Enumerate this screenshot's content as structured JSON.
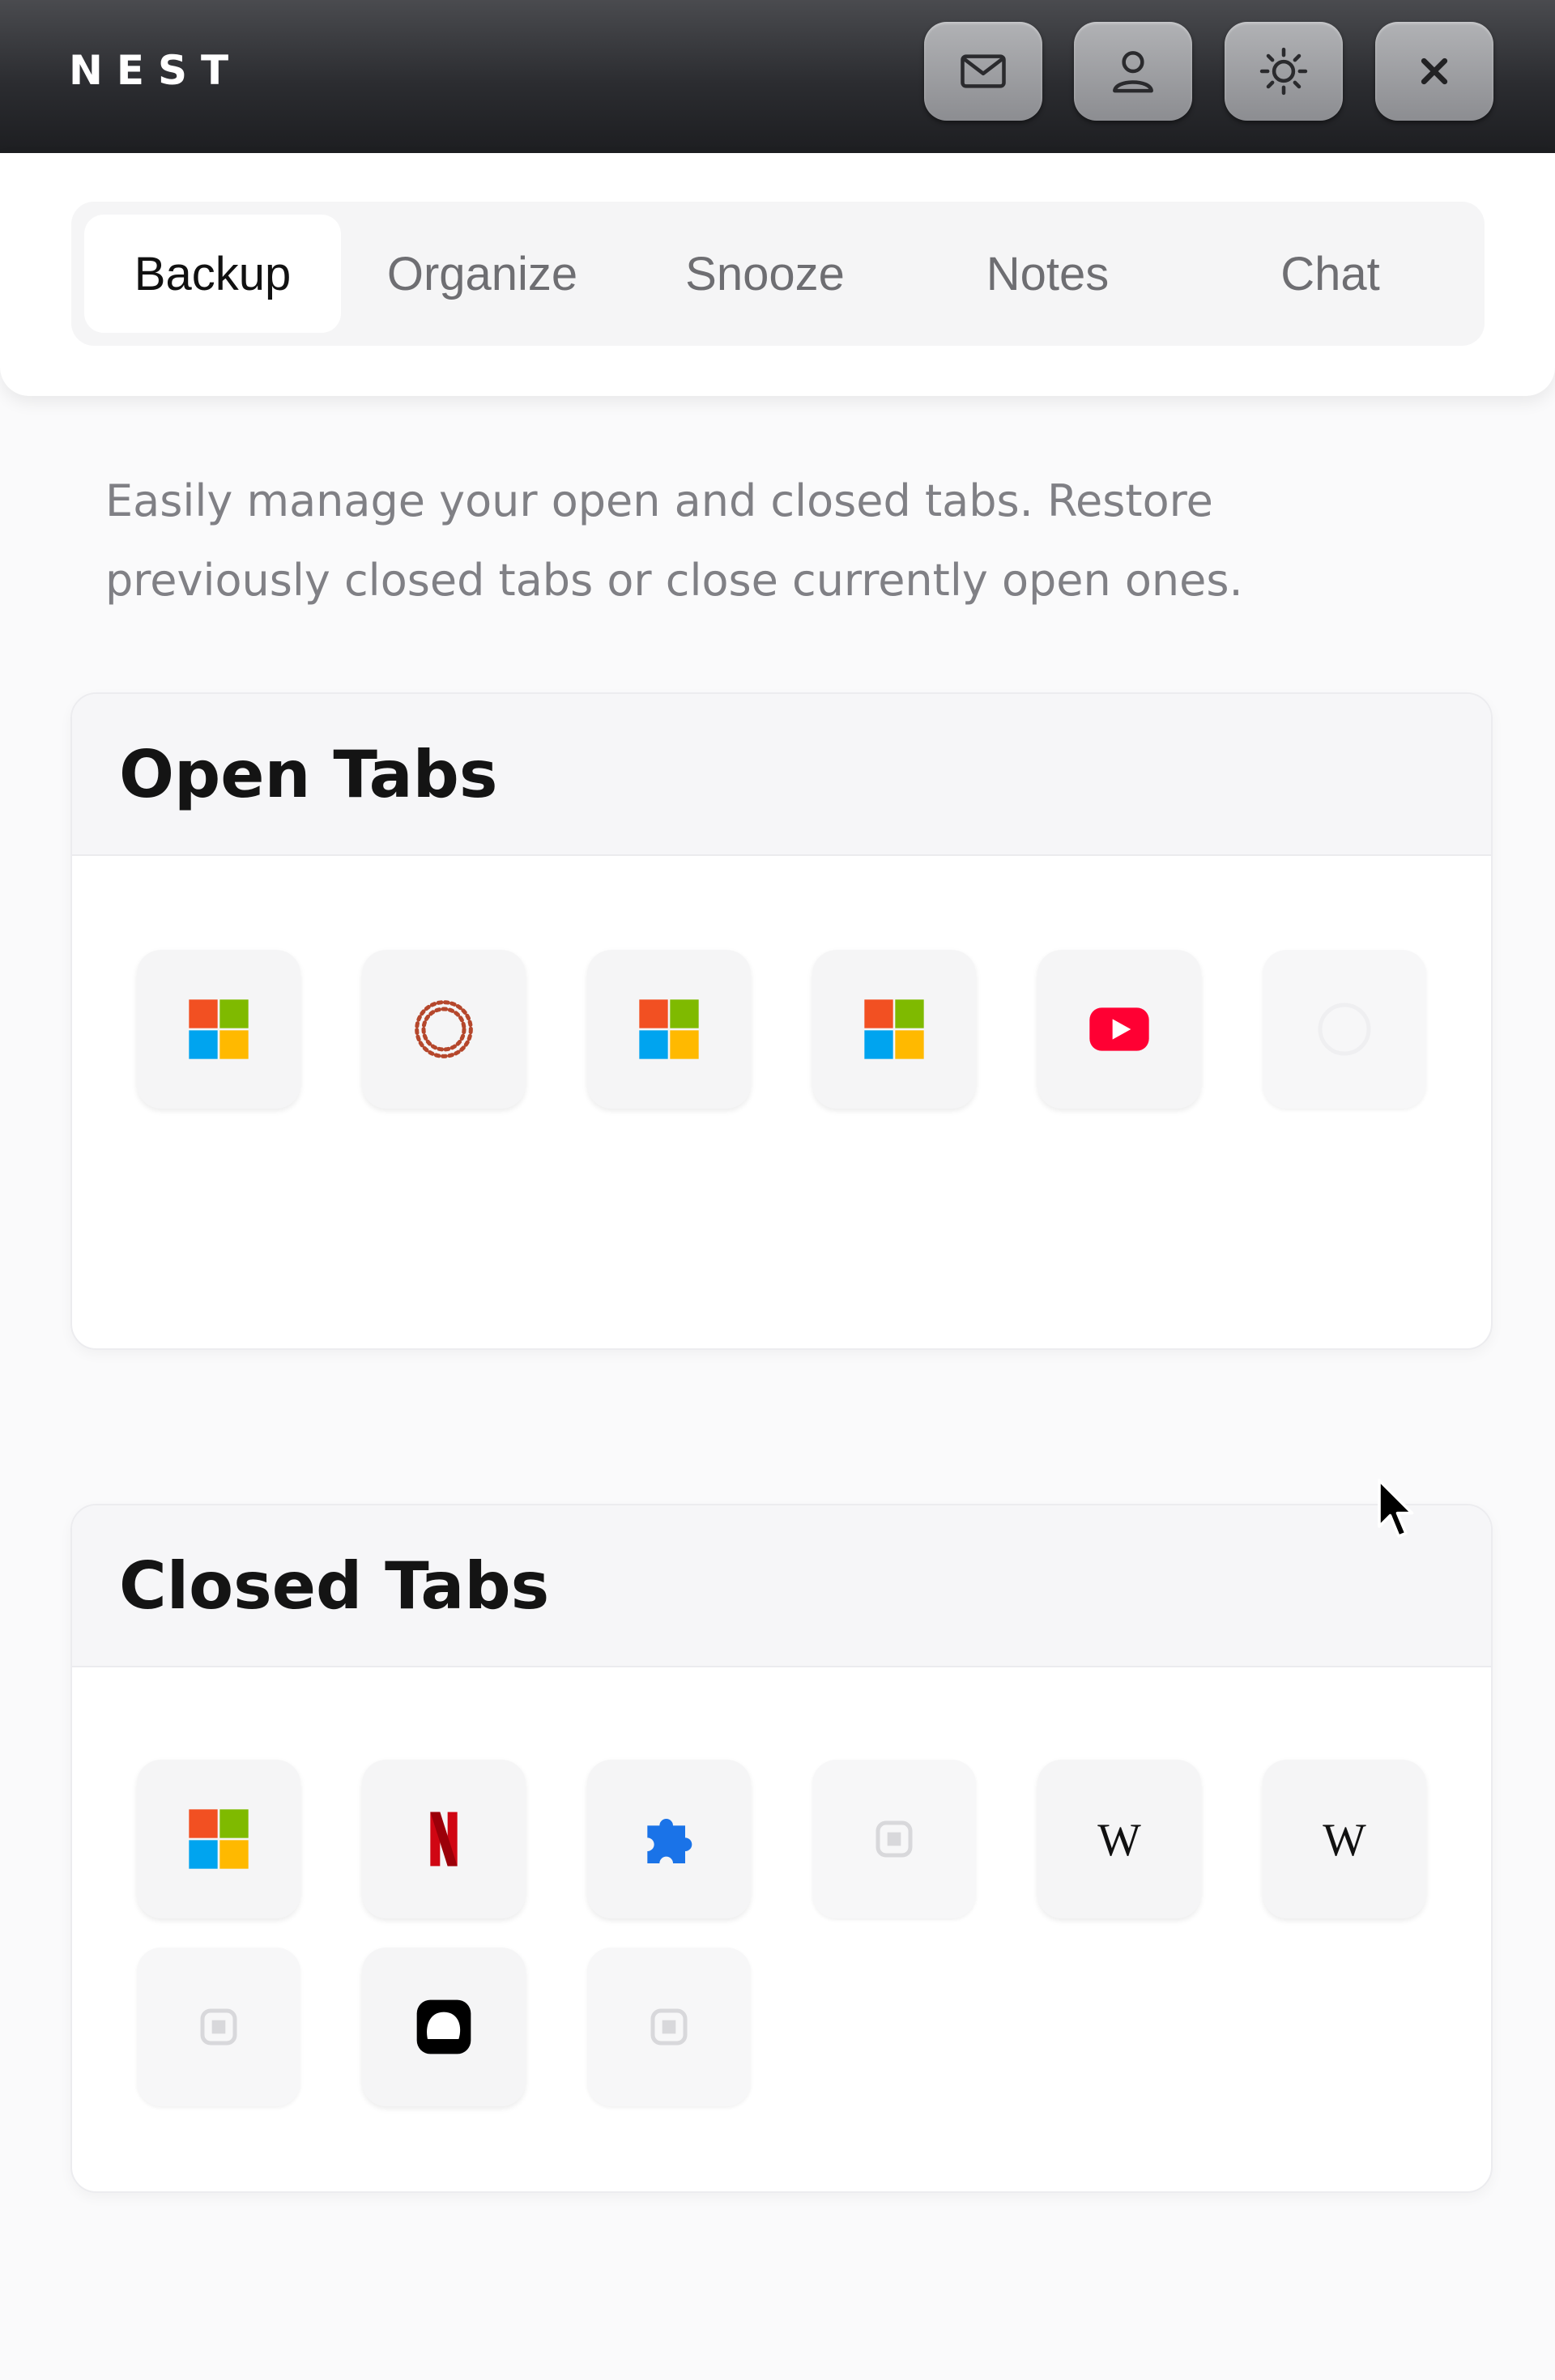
{
  "header": {
    "brand": "NEST",
    "buttons": [
      {
        "icon": "mail-icon"
      },
      {
        "icon": "user-icon"
      },
      {
        "icon": "sun-icon"
      },
      {
        "icon": "close-icon"
      }
    ]
  },
  "tabs": [
    {
      "label": "Backup",
      "active": true
    },
    {
      "label": "Organize",
      "active": false
    },
    {
      "label": "Snooze",
      "active": false
    },
    {
      "label": "Notes",
      "active": false
    },
    {
      "label": "Chat",
      "active": false
    }
  ],
  "description": "Easily manage your open and closed tabs. Restore previously closed tabs or close currently open ones.",
  "open_tabs": {
    "title": "Open Tabs",
    "items": [
      {
        "icon": "microsoft-icon"
      },
      {
        "icon": "dotted-circle-icon"
      },
      {
        "icon": "microsoft-icon"
      },
      {
        "icon": "microsoft-icon"
      },
      {
        "icon": "youtube-icon"
      },
      {
        "icon": "blank-favicon-icon"
      }
    ]
  },
  "closed_tabs": {
    "title": "Closed Tabs",
    "items": [
      {
        "icon": "microsoft-icon"
      },
      {
        "icon": "netflix-icon",
        "glyph": "N"
      },
      {
        "icon": "puzzle-icon"
      },
      {
        "icon": "generic-page-icon"
      },
      {
        "icon": "wikipedia-icon",
        "glyph": "W"
      },
      {
        "icon": "wikipedia-icon",
        "glyph": "W"
      },
      {
        "icon": "generic-page-icon"
      },
      {
        "icon": "chat-bubble-icon"
      },
      {
        "icon": "generic-page-icon"
      }
    ]
  },
  "colors": {
    "microsoft_red": "#f25022",
    "microsoft_green": "#7fba00",
    "microsoft_blue": "#00a4ef",
    "microsoft_yellow": "#ffb900",
    "youtube_red": "#ff0033",
    "netflix_red": "#d00613",
    "puzzle_blue": "#1a73e8"
  }
}
